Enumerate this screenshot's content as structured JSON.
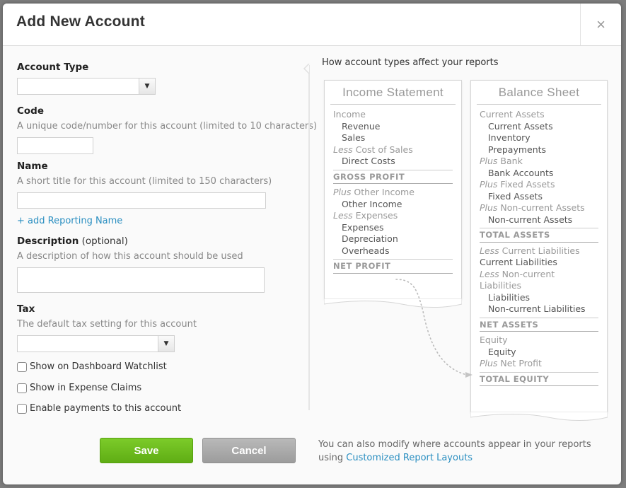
{
  "dialog": {
    "title": "Add New Account",
    "close_icon": "×"
  },
  "form": {
    "account_type": {
      "label": "Account Type",
      "value": "",
      "arrow": "▼"
    },
    "code": {
      "label": "Code",
      "hint": "A unique code/number for this account (limited to 10 characters)",
      "value": ""
    },
    "name": {
      "label": "Name",
      "hint": "A short title for this account (limited to 150 characters)",
      "value": ""
    },
    "add_reporting_name": "+ add Reporting Name",
    "description": {
      "label": "Description",
      "optional": " (optional)",
      "hint": "A description of how this account should be used",
      "value": ""
    },
    "tax": {
      "label": "Tax",
      "hint": "The default tax setting for this account",
      "value": "",
      "arrow": "▼"
    },
    "checkboxes": [
      {
        "label": "Show on Dashboard Watchlist",
        "checked": false
      },
      {
        "label": "Show in Expense Claims",
        "checked": false
      },
      {
        "label": "Enable payments to this account",
        "checked": false
      }
    ]
  },
  "side": {
    "title": "How account types affect your reports",
    "income_statement": {
      "title": "Income Statement",
      "income": "Income",
      "revenue": "Revenue",
      "sales": "Sales",
      "less": "Less",
      "cost_of_sales": " Cost of Sales",
      "direct_costs": "Direct Costs",
      "gross_profit": "GROSS PROFIT",
      "plus": "Plus",
      "other_income_group": " Other Income",
      "other_income": "Other Income",
      "expenses_group": " Expenses",
      "expenses": "Expenses",
      "depreciation": "Depreciation",
      "overheads": "Overheads",
      "net_profit": "NET PROFIT"
    },
    "balance_sheet": {
      "title": "Balance Sheet",
      "current_assets_group": "Current Assets",
      "current_assets": "Current Assets",
      "inventory": "Inventory",
      "prepayments": "Prepayments",
      "plus": "Plus",
      "less": "Less",
      "bank_group": " Bank",
      "bank_accounts": "Bank Accounts",
      "fixed_assets_group": " Fixed Assets",
      "fixed_assets": "Fixed Assets",
      "noncurrent_assets_group": " Non-current Assets",
      "noncurrent_assets": "Non-current Assets",
      "total_assets": "TOTAL ASSETS",
      "current_liabilities_group": " Current Liabilities",
      "current_liabilities": "Current Liabilities",
      "noncurrent_liabilities_group": " Non-current Liabilities",
      "liabilities": "Liabilities",
      "noncurrent_liabilities": "Non-current Liabilities",
      "net_assets": "NET ASSETS",
      "equity_group": "Equity",
      "equity": "Equity",
      "net_profit": " Net Profit",
      "total_equity": "TOTAL EQUITY"
    }
  },
  "footer": {
    "save_label": "Save",
    "cancel_label": "Cancel",
    "note": "You can also modify where accounts appear in your reports",
    "note_using": "using ",
    "link": "Customized Report Layouts"
  },
  "colors": {
    "save": "#6cbd1f",
    "cancel": "#a8a8a8",
    "link": "#2b8fc1"
  }
}
